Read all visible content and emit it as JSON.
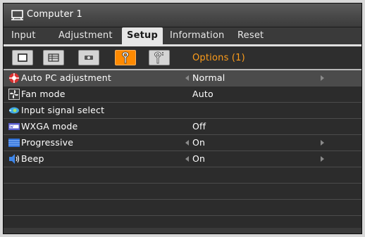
{
  "window": {
    "title": "Computer 1",
    "title_icon": "computer-monitor-icon"
  },
  "tabs": [
    {
      "label": "Input",
      "active": false
    },
    {
      "label": "Adjustment",
      "active": false
    },
    {
      "label": "Setup",
      "active": true
    },
    {
      "label": "Information",
      "active": false
    },
    {
      "label": "Reset",
      "active": false
    }
  ],
  "subtabs": {
    "items": [
      {
        "icon": "screen-general-icon",
        "active": false
      },
      {
        "icon": "menu-grid-icon",
        "active": false
      },
      {
        "icon": "installation-icon",
        "active": false
      },
      {
        "icon": "options-wrench-icon",
        "active": true
      },
      {
        "icon": "options-wrench-2-icon",
        "active": false
      }
    ],
    "active_label": "Options (1)"
  },
  "settings": [
    {
      "label": "Auto PC adjustment",
      "value": "Normal",
      "icon": "auto-adjust-icon",
      "arrows": true,
      "selected": true
    },
    {
      "label": "Fan mode",
      "value": "Auto",
      "icon": "fan-icon",
      "arrows": false,
      "selected": false
    },
    {
      "label": "Input signal select",
      "value": "",
      "icon": "input-signal-icon",
      "arrows": false,
      "selected": false
    },
    {
      "label": "WXGA mode",
      "value": "Off",
      "icon": "wxga-icon",
      "arrows": false,
      "selected": false
    },
    {
      "label": "Progressive",
      "value": "On",
      "icon": "progressive-icon",
      "arrows": true,
      "selected": false
    },
    {
      "label": "Beep",
      "value": "On",
      "icon": "speaker-icon",
      "arrows": true,
      "selected": false
    }
  ],
  "colors": {
    "accent": "#ff8a00",
    "accent_text": "#ff9d1a",
    "background": "#2c2c2c",
    "selected_row": "#4b4b4b"
  }
}
